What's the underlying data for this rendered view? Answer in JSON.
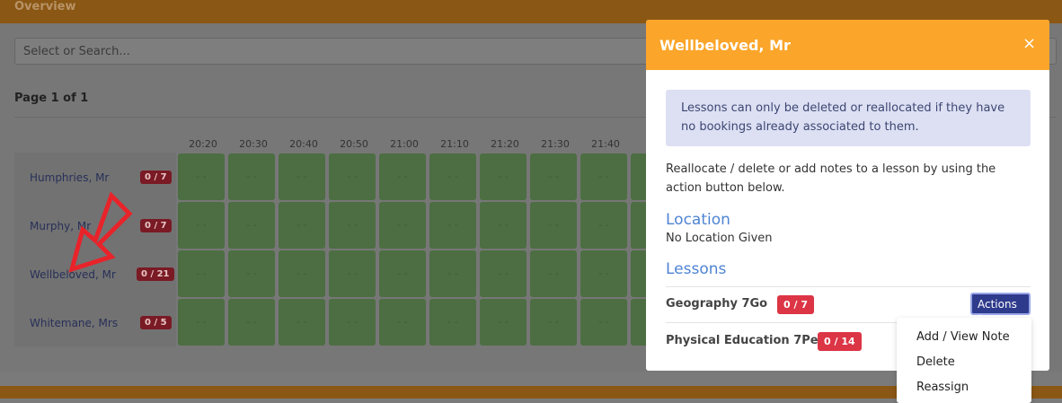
{
  "overview": {
    "title": "Overview"
  },
  "search": {
    "placeholder": "Select or Search..."
  },
  "pager": {
    "label": "Page 1 of 1"
  },
  "times": [
    "20:20",
    "20:30",
    "20:40",
    "20:50",
    "21:00",
    "21:10",
    "21:20",
    "21:30",
    "21:40",
    "2"
  ],
  "cell_text": "- -",
  "rows": [
    {
      "name": "Humphries, Mr",
      "badge": "0 / 7"
    },
    {
      "name": "Murphy, Mr",
      "badge": "0 / 7"
    },
    {
      "name": "Wellbeloved, Mr",
      "badge": "0 / 21"
    },
    {
      "name": "Whitemane, Mrs",
      "badge": "0 / 5"
    }
  ],
  "modal": {
    "title": "Wellbeloved, Mr",
    "close": "×",
    "alert": "Lessons can only be deleted or reallocated if they have no bookings already associated to them.",
    "description": "Reallocate / delete or add notes to a lesson by using the action button below.",
    "location_heading": "Location",
    "location_value": "No Location Given",
    "lessons_heading": "Lessons",
    "lessons": [
      {
        "name": "Geography 7Go",
        "badge": "0 / 7"
      },
      {
        "name": "Physical Education 7Pe",
        "badge": "0 / 14"
      }
    ],
    "actions_label": "Actions ▾"
  },
  "dropdown": {
    "items": [
      "Add / View Note",
      "Delete",
      "Reassign"
    ]
  },
  "colors": {
    "header": "#fba52a",
    "accent": "#4f84d2",
    "badge": "#dc3545",
    "cell": "#4c6e42",
    "actions": "#2e3a8c"
  }
}
